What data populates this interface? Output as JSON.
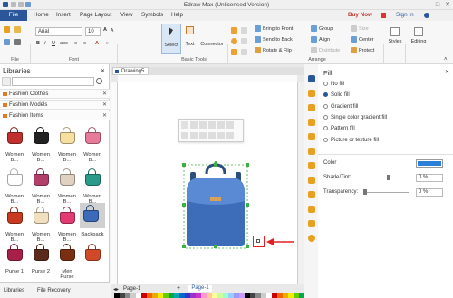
{
  "window": {
    "title": "Edraw Max (Unlicensed Version)"
  },
  "tabs": [
    "File",
    "Home",
    "Insert",
    "Page Layout",
    "View",
    "Symbols",
    "Help"
  ],
  "topright": {
    "buy_now": "Buy Now",
    "sign_in": "Sign In"
  },
  "ribbon": {
    "font_name": "Arial",
    "font_size": "10",
    "groups": {
      "file": "File",
      "font": "Font",
      "basic_tools": "Basic Tools",
      "arrange": "Arrange"
    },
    "select_label": "Select",
    "text_label": "Text",
    "connector_label": "Connector",
    "arrange": {
      "bring_front": "Bring to Front",
      "send_back": "Send to Back",
      "rotate_flip": "Rotate & Flip",
      "group": "Group",
      "align": "Align",
      "distribute": "Distribute",
      "size": "Size",
      "center": "Center",
      "protect": "Protect"
    },
    "styles": "Styles",
    "editing": "Editing"
  },
  "libraries": {
    "title": "Libraries",
    "sections": [
      "Fashion Clothes",
      "Fashion Models",
      "Fashion Items"
    ],
    "shapes": [
      {
        "label": "Women B...",
        "color": "#c0302c"
      },
      {
        "label": "Women B...",
        "color": "#222222"
      },
      {
        "label": "Women B...",
        "color": "#f5e0a0"
      },
      {
        "label": "Women B...",
        "color": "#e87a9a"
      },
      {
        "label": "Women B...",
        "color": "#ffffff"
      },
      {
        "label": "Women B...",
        "color": "#b0406a"
      },
      {
        "label": "Women B...",
        "color": "#e0d2c0"
      },
      {
        "label": "Women B...",
        "color": "#2a9a8a"
      },
      {
        "label": "Women B...",
        "color": "#c83a20"
      },
      {
        "label": "Women B...",
        "color": "#f0e0c0"
      },
      {
        "label": "Women B...",
        "color": "#e23b72"
      },
      {
        "label": "Backpack",
        "color": "#3a6ab8"
      },
      {
        "label": "Purse 1",
        "color": "#a8204a"
      },
      {
        "label": "Purse 2",
        "color": "#5a2a1a"
      },
      {
        "label": "Men Purse",
        "color": "#7a3010"
      },
      {
        "label": "",
        "color": "#d04a2a"
      }
    ],
    "footer_tabs": [
      "Libraries",
      "File Recovery"
    ]
  },
  "document": {
    "tab": "Drawing5",
    "page_tab": "Page-1",
    "page_tab_active": "Page-1"
  },
  "fill": {
    "title": "Fill",
    "options": [
      {
        "label": "No fill",
        "selected": false
      },
      {
        "label": "Solid fill",
        "selected": true
      },
      {
        "label": "Gradient fill",
        "selected": false
      },
      {
        "label": "Single color gradient fill",
        "selected": false
      },
      {
        "label": "Pattern fill",
        "selected": false
      },
      {
        "label": "Picture or texture fill",
        "selected": false
      }
    ],
    "color_label": "Color",
    "color_value": "#2b7fd8",
    "shade_label": "Shade/Tint:",
    "shade_value": "0 %",
    "transparency_label": "Transparency:",
    "transparency_value": "0 %"
  }
}
